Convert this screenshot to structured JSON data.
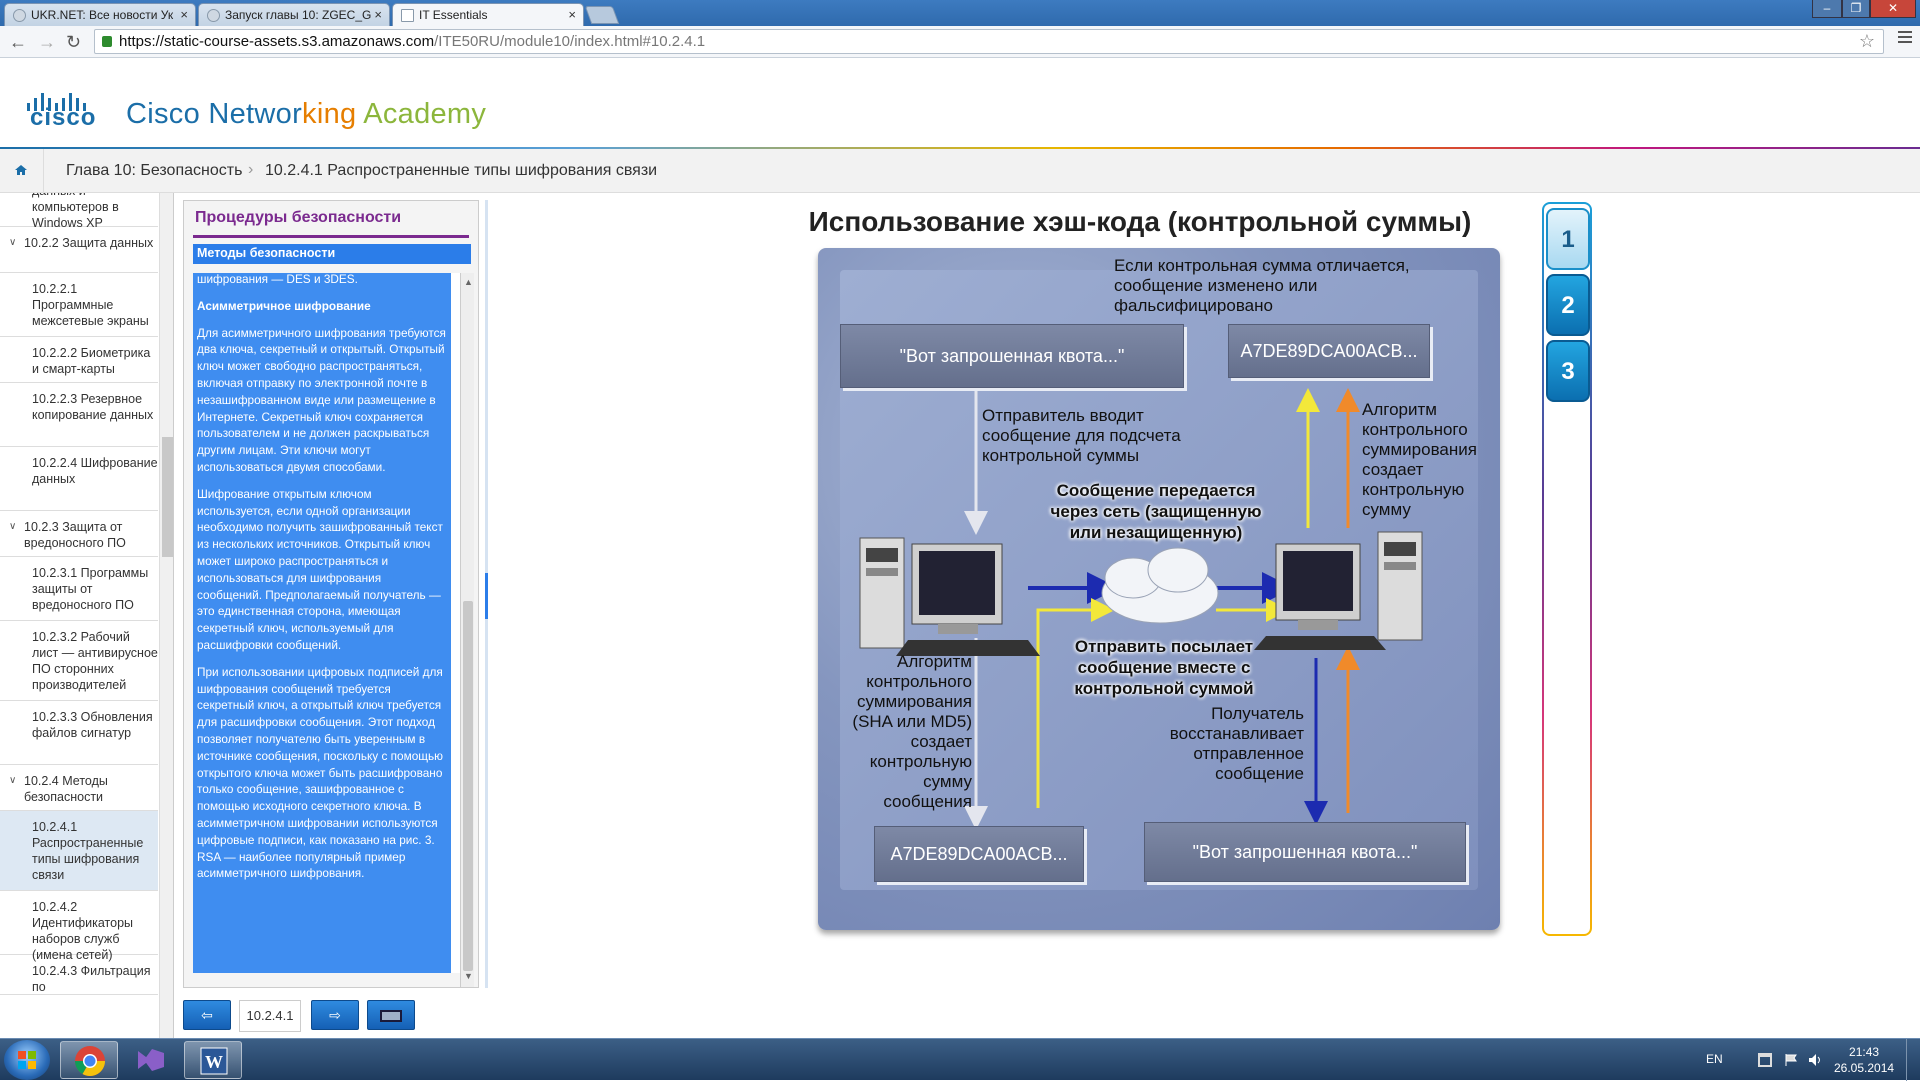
{
  "browser": {
    "tabs": [
      {
        "title": "UKR.NET: Все новости Ук"
      },
      {
        "title": "Запуск главы 10: ZGEC_G"
      },
      {
        "title": "IT Essentials"
      }
    ],
    "url_host": "https://static-course-assets.s3.amazonaws.com",
    "url_path": "/ITE50RU/module10/index.html#10.2.4.1"
  },
  "header": {
    "logo_word": "cisco",
    "title_parts": [
      {
        "text": "Cisco Networ",
        "color": "#1b6ea8"
      },
      {
        "text": "king ",
        "color": "#e67e00"
      },
      {
        "text": "Academy",
        "color": "#8cb63c"
      }
    ]
  },
  "breadcrumb": {
    "chapter": "Глава 10: Безопасность",
    "separator": "›",
    "section": "10.2.4.1 Распространенные типы шифрования связи"
  },
  "sidebar": {
    "items": [
      {
        "text": "данных и компьютеров в Windows XP",
        "level": 2
      },
      {
        "text": "10.2.2 Защита данных",
        "level": 1
      },
      {
        "text": "10.2.2.1 Программные межсетевые экраны",
        "level": 2
      },
      {
        "text": "10.2.2.2 Биометрика и смарт-карты",
        "level": 2
      },
      {
        "text": "10.2.2.3 Резервное копирование данных",
        "level": 2
      },
      {
        "text": "10.2.2.4 Шифрование данных",
        "level": 2
      },
      {
        "text": "10.2.3 Защита от вредоносного ПО",
        "level": 1
      },
      {
        "text": "10.2.3.1 Программы защиты от вредоносного ПО",
        "level": 2
      },
      {
        "text": "10.2.3.2 Рабочий лист — антивирусное ПО сторонних производителей",
        "level": 2
      },
      {
        "text": "10.2.3.3 Обновления файлов сигнатур",
        "level": 2
      },
      {
        "text": "10.2.4 Методы безопасности",
        "level": 1
      },
      {
        "text": "10.2.4.1 Распространенные типы шифрования связи",
        "level": 2,
        "active": true
      },
      {
        "text": "10.2.4.2 Идентификаторы наборов служб (имена сетей)",
        "level": 2
      },
      {
        "text": "10.2.4.3 Фильтрация по",
        "level": 2
      }
    ]
  },
  "panel": {
    "title": "Процедуры безопасности",
    "subtitle": "Методы безопасности",
    "top_fragment": "шифрования — DES и 3DES.",
    "heading": "Асимметричное шифрование",
    "paragraphs": [
      "Для асимметричного шифрования требуются два ключа, секретный и открытый. Открытый ключ может свободно распространяться, включая отправку по электронной почте в незашифрованном виде или размещение в Интернете. Секретный ключ сохраняется пользователем и не должен раскрываться другим лицам. Эти ключи могут использоваться двумя способами.",
      "Шифрование открытым ключом используется, если одной организации необходимо получить зашифрованный текст из нескольких источников. Открытый ключ может широко распространяться и использоваться для шифрования сообщений. Предполагаемый получатель — это единственная сторона, имеющая секретный ключ, используемый для расшифровки сообщений.",
      "При использовании цифровых подписей для шифрования сообщений требуется секретный ключ, а открытый ключ требуется для расшифровки сообщения. Этот подход позволяет получателю быть уверенным в источнике сообщения, поскольку с помощью открытого ключа может быть расшифровано только сообщение, зашифрованное с помощью исходного секретного ключа. В асимметричном шифровании используются цифровые подписи, как показано на рис. 3. RSA — наиболее популярный пример асимметричного шифрования."
    ]
  },
  "bottom_nav": {
    "page": "10.2.4.1"
  },
  "main": {
    "title": "Использование хэш-кода (контрольной суммы)",
    "diagram": {
      "box_quote": "\"Вот запрошенная квота...\"",
      "box_hash": "A7DE89DCA00ACB...",
      "text_differs": "Если контрольная сумма отличается, сообщение изменено или фальсифицировано",
      "text_sender": "Отправитель вводит сообщение для подсчета контрольной суммы",
      "text_algo_right": "Алгоритм контрольного суммирования создает контрольную сумму",
      "text_network": "Сообщение передается через сеть (защищенную или незащищенную)",
      "text_send_with": "Отправить посылает сообщение вместе с контрольной суммой",
      "text_algo_left": "Алгоритм контрольного суммирования (SHA или MD5) создает контрольную сумму сообщения",
      "text_receiver": "Получатель восстанавливает отправленное сообщение"
    },
    "steps": [
      "1",
      "2",
      "3"
    ]
  },
  "taskbar": {
    "lang": "EN",
    "time": "21:43",
    "date": "26.05.2014"
  }
}
